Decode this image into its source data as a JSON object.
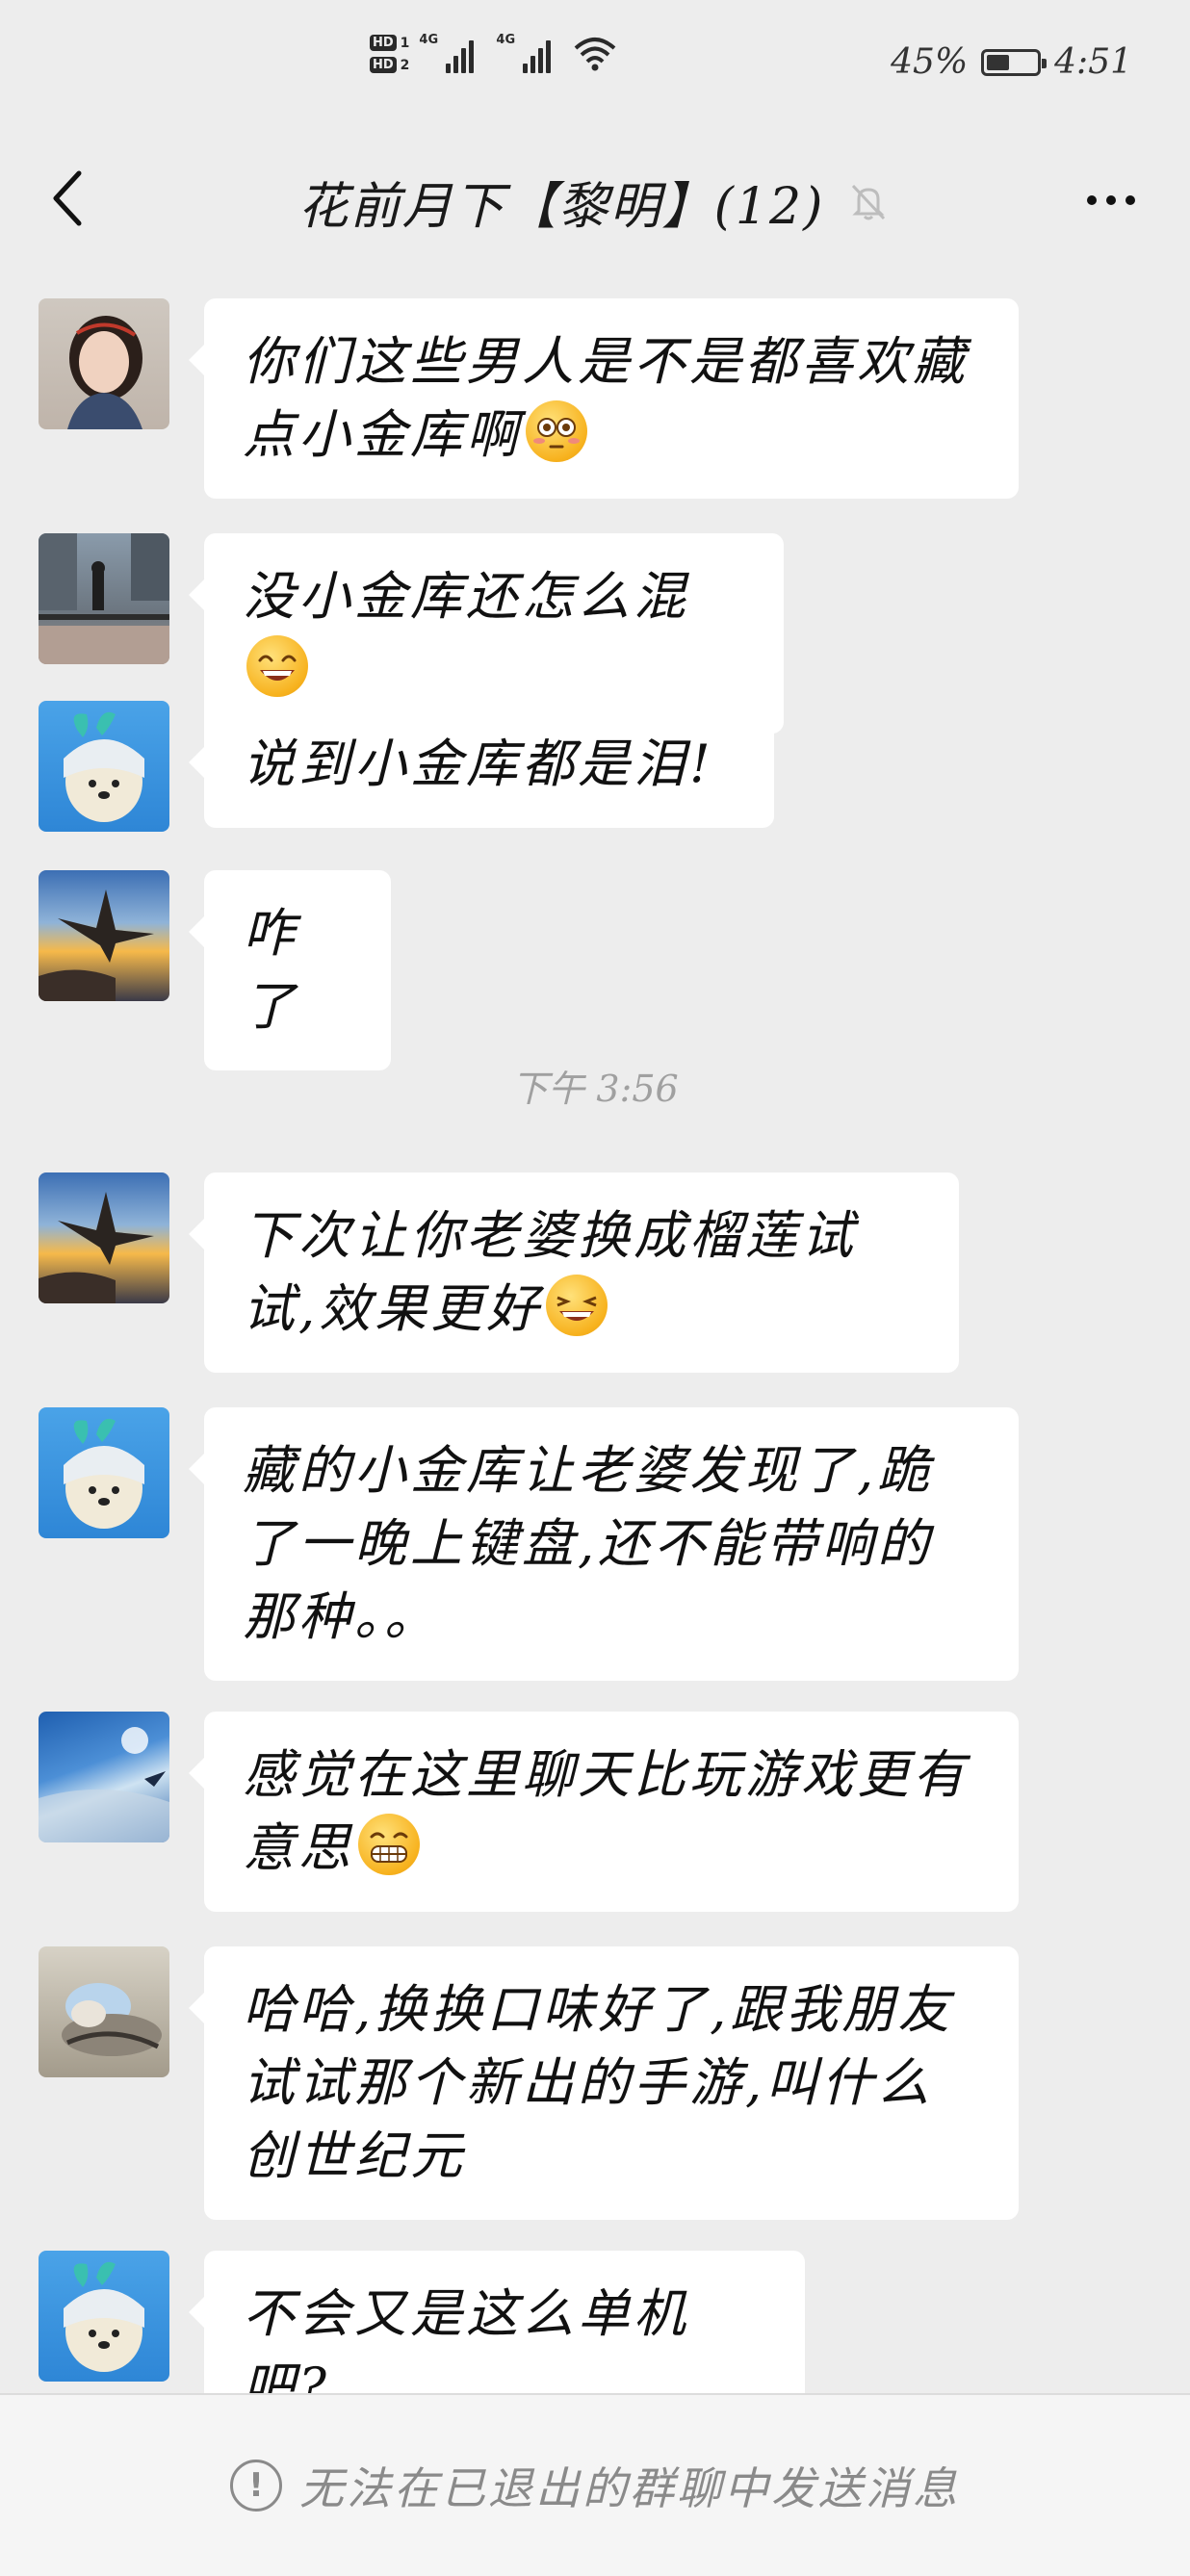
{
  "status_bar": {
    "hd1": "HD",
    "hd1_sub": "1",
    "hd2": "HD",
    "hd2_sub": "2",
    "net1": "4G",
    "net2": "4G",
    "battery_percent": "45%",
    "battery_level": 0.45,
    "time": "4:51"
  },
  "header": {
    "title": "花前月下【黎明】(12)",
    "back_icon": "chevron-left-icon",
    "mute_icon": "bell-muted-icon",
    "more_icon": "more-dots-icon"
  },
  "messages": [
    {
      "text": "你们这些男人是不是都喜欢藏点小金库啊",
      "emoji": "flushed-face-emoji",
      "avatar": "avatar-woman-photo"
    },
    {
      "text": "没小金库还怎么混",
      "emoji": "grinning-face-emoji",
      "avatar": "avatar-balcony-photo"
    },
    {
      "text": "说到小金库都是泪!",
      "emoji": "",
      "avatar": "avatar-dog-hood"
    },
    {
      "text": "咋了",
      "emoji": "",
      "avatar": "avatar-eagle-sunset"
    },
    {
      "text": "下次让你老婆换成榴莲试试,效果更好",
      "emoji": "smiling-squint-emoji",
      "avatar": "avatar-eagle-sunset"
    },
    {
      "text": "藏的小金库让老婆发现了,跪了一晚上键盘,还不能带响的那种。。",
      "emoji": "",
      "avatar": "avatar-dog-hood"
    },
    {
      "text": "感觉在这里聊天比玩游戏更有意思",
      "emoji": "grimacing-face-emoji",
      "avatar": "avatar-plane-sky"
    },
    {
      "text": "哈哈,换换口味好了,跟我朋友试试那个新出的手游,叫什么创世纪元",
      "emoji": "",
      "avatar": "avatar-cat-sleeping"
    },
    {
      "text": "不会又是这么单机吧?",
      "emoji": "",
      "avatar": "avatar-dog-hood"
    }
  ],
  "timestamp": "下午 3:56",
  "bottom_bar": {
    "notice_icon": "exclamation-circle-icon",
    "notice_text": "无法在已退出的群聊中发送消息"
  }
}
